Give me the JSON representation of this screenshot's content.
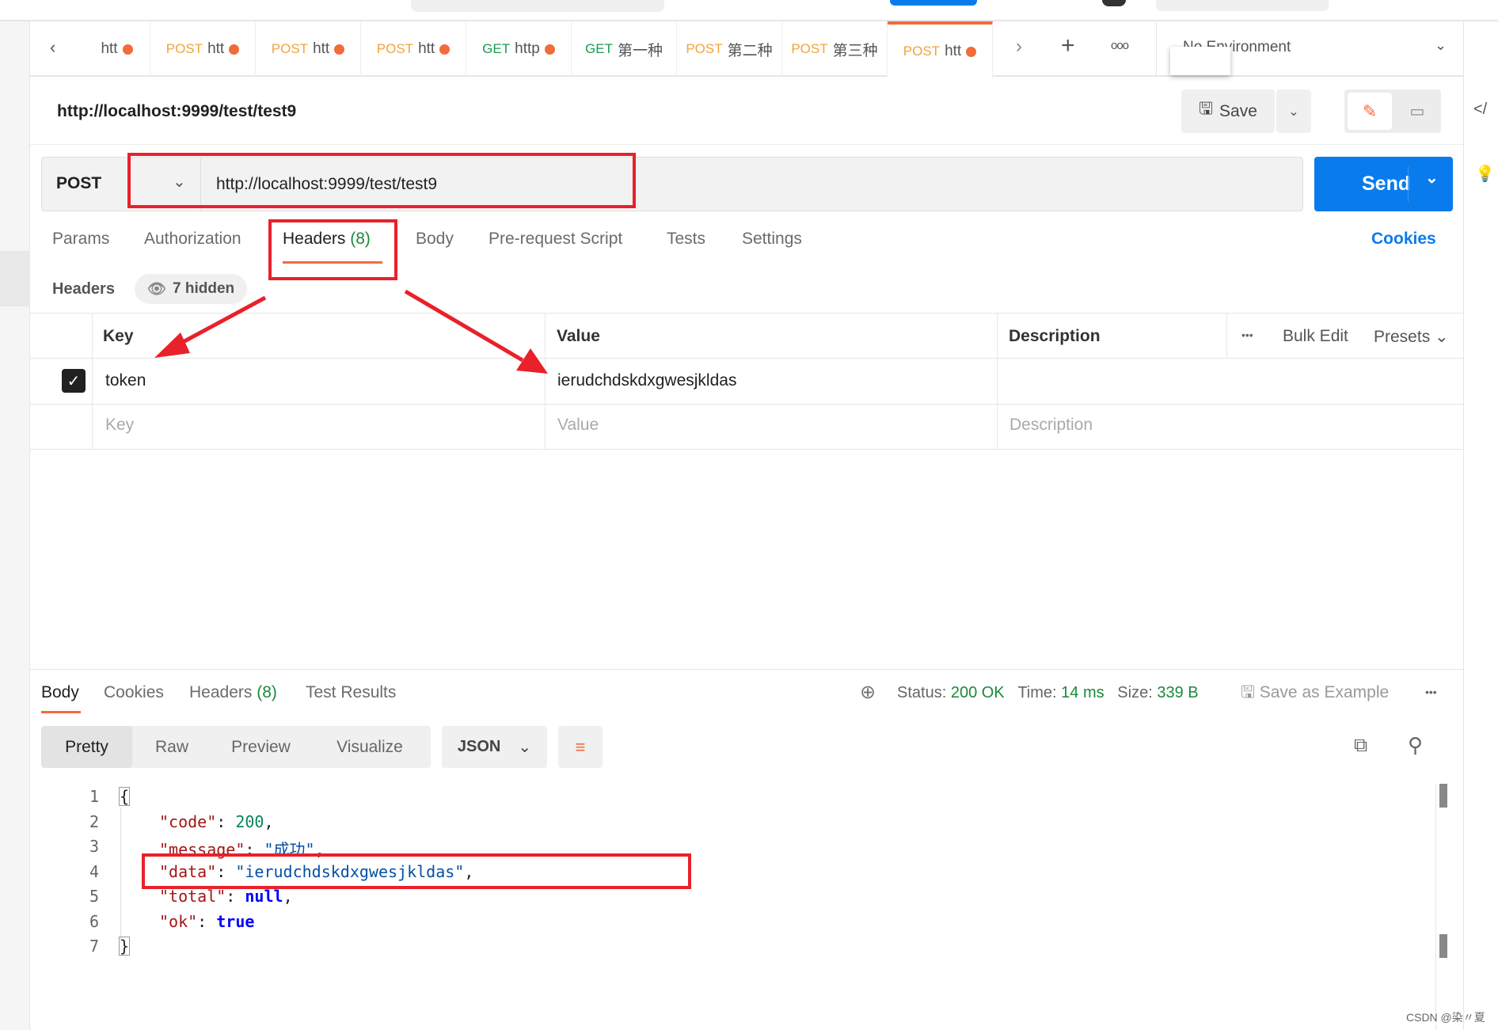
{
  "tabs": [
    {
      "method": "",
      "label": "htt"
    },
    {
      "method": "POST",
      "label": "htt"
    },
    {
      "method": "POST",
      "label": "htt"
    },
    {
      "method": "POST",
      "label": "htt"
    },
    {
      "method": "GET",
      "label": "http"
    },
    {
      "method": "GET",
      "label": "第一种"
    },
    {
      "method": "POST",
      "label": "第二种"
    },
    {
      "method": "POST",
      "label": "第三种"
    },
    {
      "method": "POST",
      "label": "htt"
    }
  ],
  "environment": "No Environment",
  "request": {
    "title": "http://localhost:9999/test/test9",
    "save_label": "Save",
    "method": "POST",
    "url": "http://localhost:9999/test/test9",
    "send_label": "Send"
  },
  "req_tabs": {
    "params": "Params",
    "authorization": "Authorization",
    "headers": "Headers",
    "headers_count": "(8)",
    "body": "Body",
    "prerequest": "Pre-request Script",
    "tests": "Tests",
    "settings": "Settings",
    "cookies": "Cookies"
  },
  "headers_section": {
    "label": "Headers",
    "hidden": "7 hidden"
  },
  "table": {
    "key": "Key",
    "value": "Value",
    "description": "Description",
    "bulk_edit": "Bulk Edit",
    "presets": "Presets",
    "rows": [
      {
        "key": "token",
        "value": "ierudchdskdxgwesjkldas",
        "checked": true
      }
    ],
    "placeholder": {
      "key": "Key",
      "value": "Value",
      "description": "Description"
    }
  },
  "response": {
    "tabs": {
      "body": "Body",
      "cookies": "Cookies",
      "headers": "Headers",
      "headers_count": "(8)",
      "test_results": "Test Results"
    },
    "status_label": "Status:",
    "status": "200 OK",
    "time_label": "Time:",
    "time": "14 ms",
    "size_label": "Size:",
    "size": "339 B",
    "save_example": "Save as Example",
    "views": {
      "pretty": "Pretty",
      "raw": "Raw",
      "preview": "Preview",
      "visualize": "Visualize"
    },
    "format": "JSON"
  },
  "code": {
    "lines": [
      "1",
      "2",
      "3",
      "4",
      "5",
      "6",
      "7"
    ],
    "open": "{",
    "close": "}",
    "k_code": "\"code\"",
    "v_code": "200",
    "k_message": "\"message\"",
    "v_message": "\"成功\"",
    "k_data": "\"data\"",
    "v_data": "\"ierudchdskdxgwesjkldas\"",
    "k_total": "\"total\"",
    "v_total": "null",
    "k_ok": "\"ok\"",
    "v_ok": "true"
  },
  "watermark": "CSDN @染〃夏"
}
